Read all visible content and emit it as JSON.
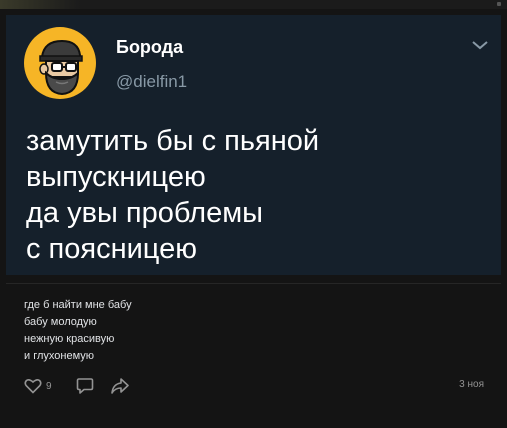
{
  "tweet": {
    "display_name": "Борода",
    "handle": "@dielfin1",
    "text": "замутить бы с пьяной\nвыпускницею\nда увы проблемы\nс поясницею"
  },
  "post": {
    "text": "где б найти мне бабу\nбабу молодую\nнежную красивую\nи глухонемую",
    "likes": "9",
    "date": "3 ноя"
  },
  "icons": {
    "like": "heart-icon",
    "comment": "comment-icon",
    "share": "share-icon",
    "menu": "chevron-down-icon"
  },
  "colors": {
    "page_bg": "#141414",
    "card_bg": "#15202b",
    "avatar_bg": "#f6b526",
    "muted": "#939393"
  }
}
